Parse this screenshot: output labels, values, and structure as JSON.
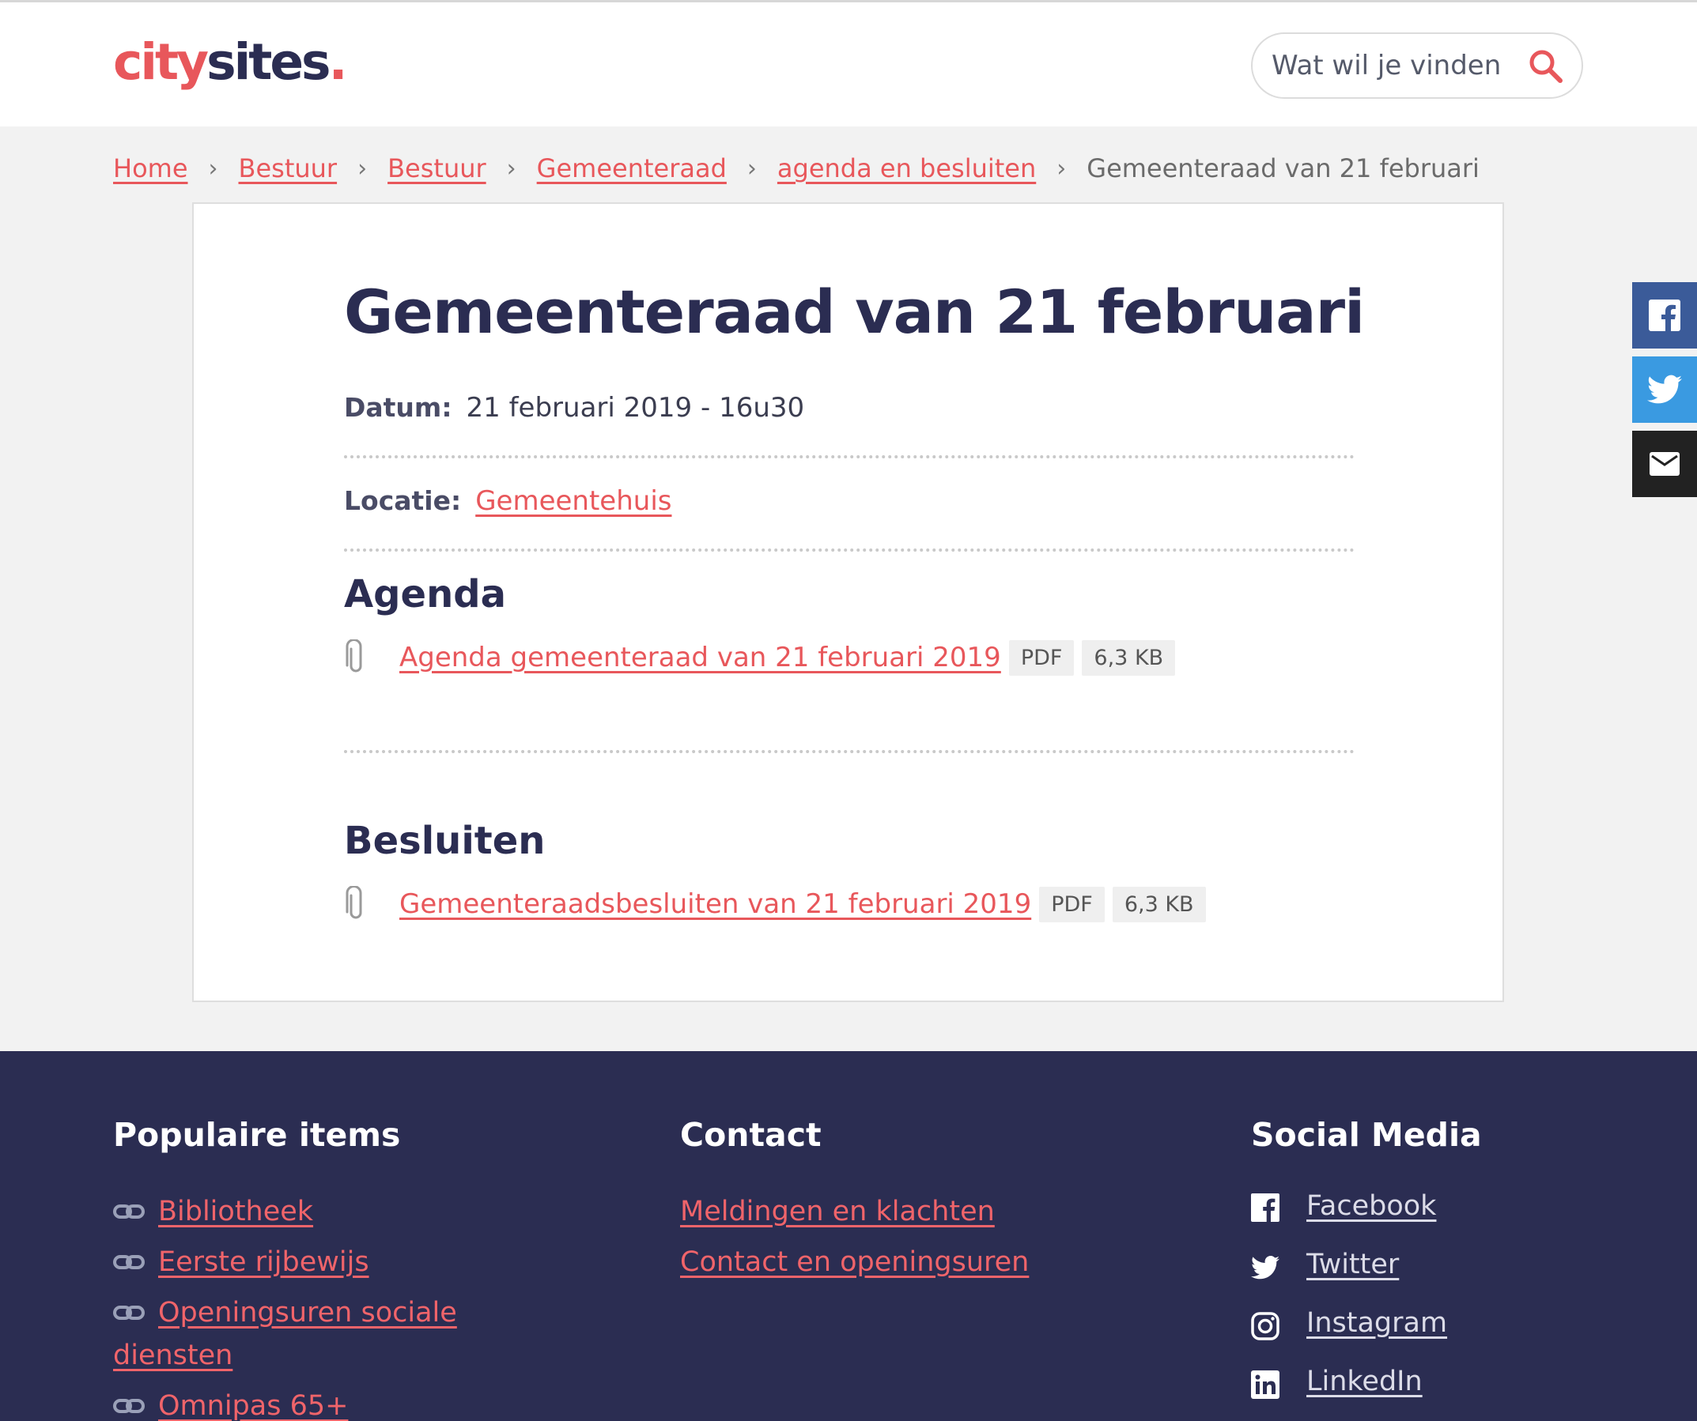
{
  "header": {
    "logo": {
      "part1": "city",
      "part2": "sites",
      "part3": "."
    },
    "search": {
      "placeholder": "Wat wil je vinden"
    }
  },
  "breadcrumb": {
    "items": [
      "Home",
      "Bestuur",
      "Bestuur",
      "Gemeenteraad",
      "agenda en besluiten"
    ],
    "current": "Gemeenteraad van 21 februari",
    "separator": "›"
  },
  "main": {
    "title": "Gemeenteraad van 21 februari",
    "date_label": "Datum:",
    "date_value": "21 februari 2019 - 16u30",
    "location_label": "Locatie:",
    "location_value": "Gemeentehuis",
    "agenda": {
      "heading": "Agenda",
      "file": {
        "label": "Agenda gemeenteraad van 21 februari 2019",
        "type": "PDF",
        "size": "6,3 KB"
      }
    },
    "besluiten": {
      "heading": "Besluiten",
      "file": {
        "label": "Gemeenteraadsbesluiten van 21 februari 2019",
        "type": "PDF",
        "size": "6,3 KB"
      }
    }
  },
  "share": {
    "icons": [
      "facebook-icon",
      "twitter-icon",
      "mail-icon"
    ]
  },
  "footer": {
    "popular": {
      "heading": "Populaire items",
      "items": [
        "Bibliotheek",
        "Eerste rijbewijs",
        "Openingsuren sociale diensten",
        "Omnipas 65+"
      ]
    },
    "contact": {
      "heading": "Contact",
      "items": [
        "Meldingen en klachten",
        "Contact en openingsuren"
      ]
    },
    "social": {
      "heading": "Social Media",
      "items": [
        "Facebook",
        "Twitter",
        "Instagram",
        "LinkedIn"
      ]
    }
  },
  "colors": {
    "accent": "#e8575b",
    "navy": "#2b2d52",
    "facebook": "#3b5b99",
    "twitter": "#3a9ae1",
    "mail": "#222222"
  }
}
